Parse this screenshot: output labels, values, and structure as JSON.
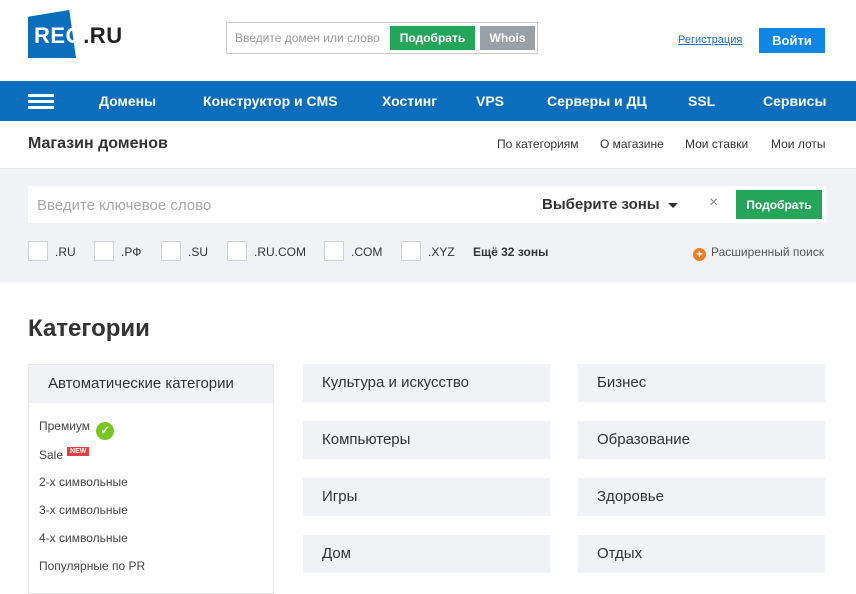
{
  "header": {
    "logo": {
      "main": "REG",
      "suffix": ".RU"
    },
    "domain_search": {
      "placeholder": "Введите домен или слово",
      "pick_label": "Подобрать",
      "whois_label": "Whois"
    },
    "register_link": "Регистрация",
    "login_label": "Войти"
  },
  "nav": {
    "items": [
      "Домены",
      "Конструктор и CMS",
      "Хостинг",
      "VPS",
      "Серверы и ДЦ",
      "SSL",
      "Сервисы"
    ]
  },
  "subheader": {
    "title": "Магазин доменов",
    "links": [
      "По категориям",
      "О магазине",
      "Мои ставки",
      "Мои лоты"
    ]
  },
  "filter": {
    "keyword_placeholder": "Введите ключевое слово",
    "zones_label": "Выберите зоны",
    "clear_symbol": "×",
    "search_label": "Подобрать",
    "zones": [
      ".RU",
      ".РФ",
      ".SU",
      ".RU.COM",
      ".COM",
      ".XYZ"
    ],
    "more_zones": "Ещё 32 зоны",
    "advanced_label": "Расширенный поиск"
  },
  "categories": {
    "title": "Категории",
    "auto": {
      "heading": "Автоматические категории",
      "items": [
        "Премиум",
        "Sale",
        "2-х символьные",
        "3-х символьные",
        "4-х символьные",
        "Популярные по PR"
      ],
      "new_badge": "NEW"
    },
    "left_column": [
      "Культура и искусство",
      "Компьютеры",
      "Игры",
      "Дом"
    ],
    "right_column": [
      "Бизнес",
      "Образование",
      "Здоровье",
      "Отдых"
    ]
  },
  "colors": {
    "brand_blue": "#0a6ebd",
    "accent_green": "#24a55a",
    "login_blue": "#0d86e5",
    "orange": "#f47c20"
  }
}
